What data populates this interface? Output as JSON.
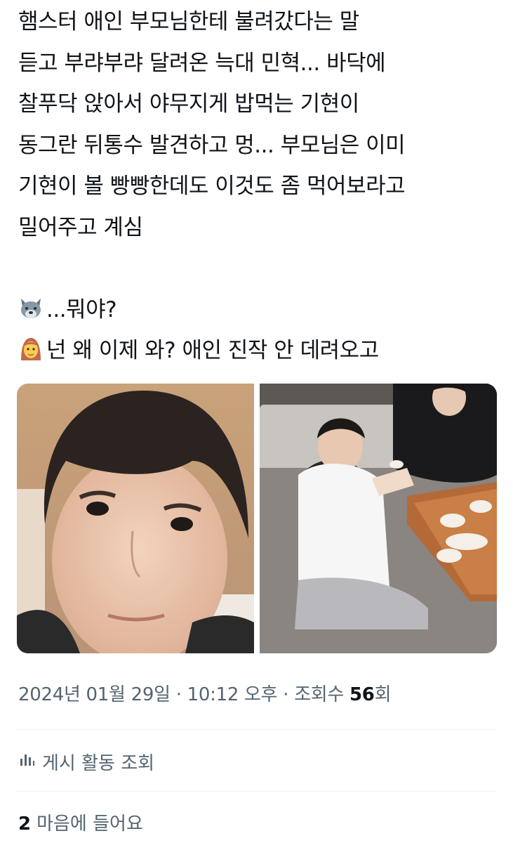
{
  "tweet": {
    "lines": [
      "햄스터 애인 부모님한테 불려갔다는 말",
      "듣고 부랴부랴 달려온 늑대 민혁... 바닥에",
      "찰푸닥 앉아서 야무지게 밥먹는 기현이",
      "동그란 뒤통수 발견하고 멍... 부모님은 이미",
      "기현이 볼 빵빵한데도 이것도 좀 먹어보라고",
      "밀어주고 계심"
    ],
    "dialogue": [
      {
        "icon": "wolf-emoji",
        "text": "...뭐야?"
      },
      {
        "icon": "woman-emoji",
        "text": "넌 왜 이제 와? 애인 진작 안 데려오고"
      }
    ]
  },
  "meta": {
    "date": "2024년 01월 29일",
    "separator1": " · ",
    "time": "10:12 오후",
    "separator2": " · ",
    "views_label": "조회수 ",
    "views_count": "56",
    "views_suffix": "회"
  },
  "activity": {
    "icon": "bar-chart-icon",
    "label": "게시 활동 조회"
  },
  "likes": {
    "count": "2",
    "label": "마음에 들어요"
  },
  "colors": {
    "text": "#0f1419",
    "secondary": "#536471",
    "divider": "#eff3f4"
  }
}
